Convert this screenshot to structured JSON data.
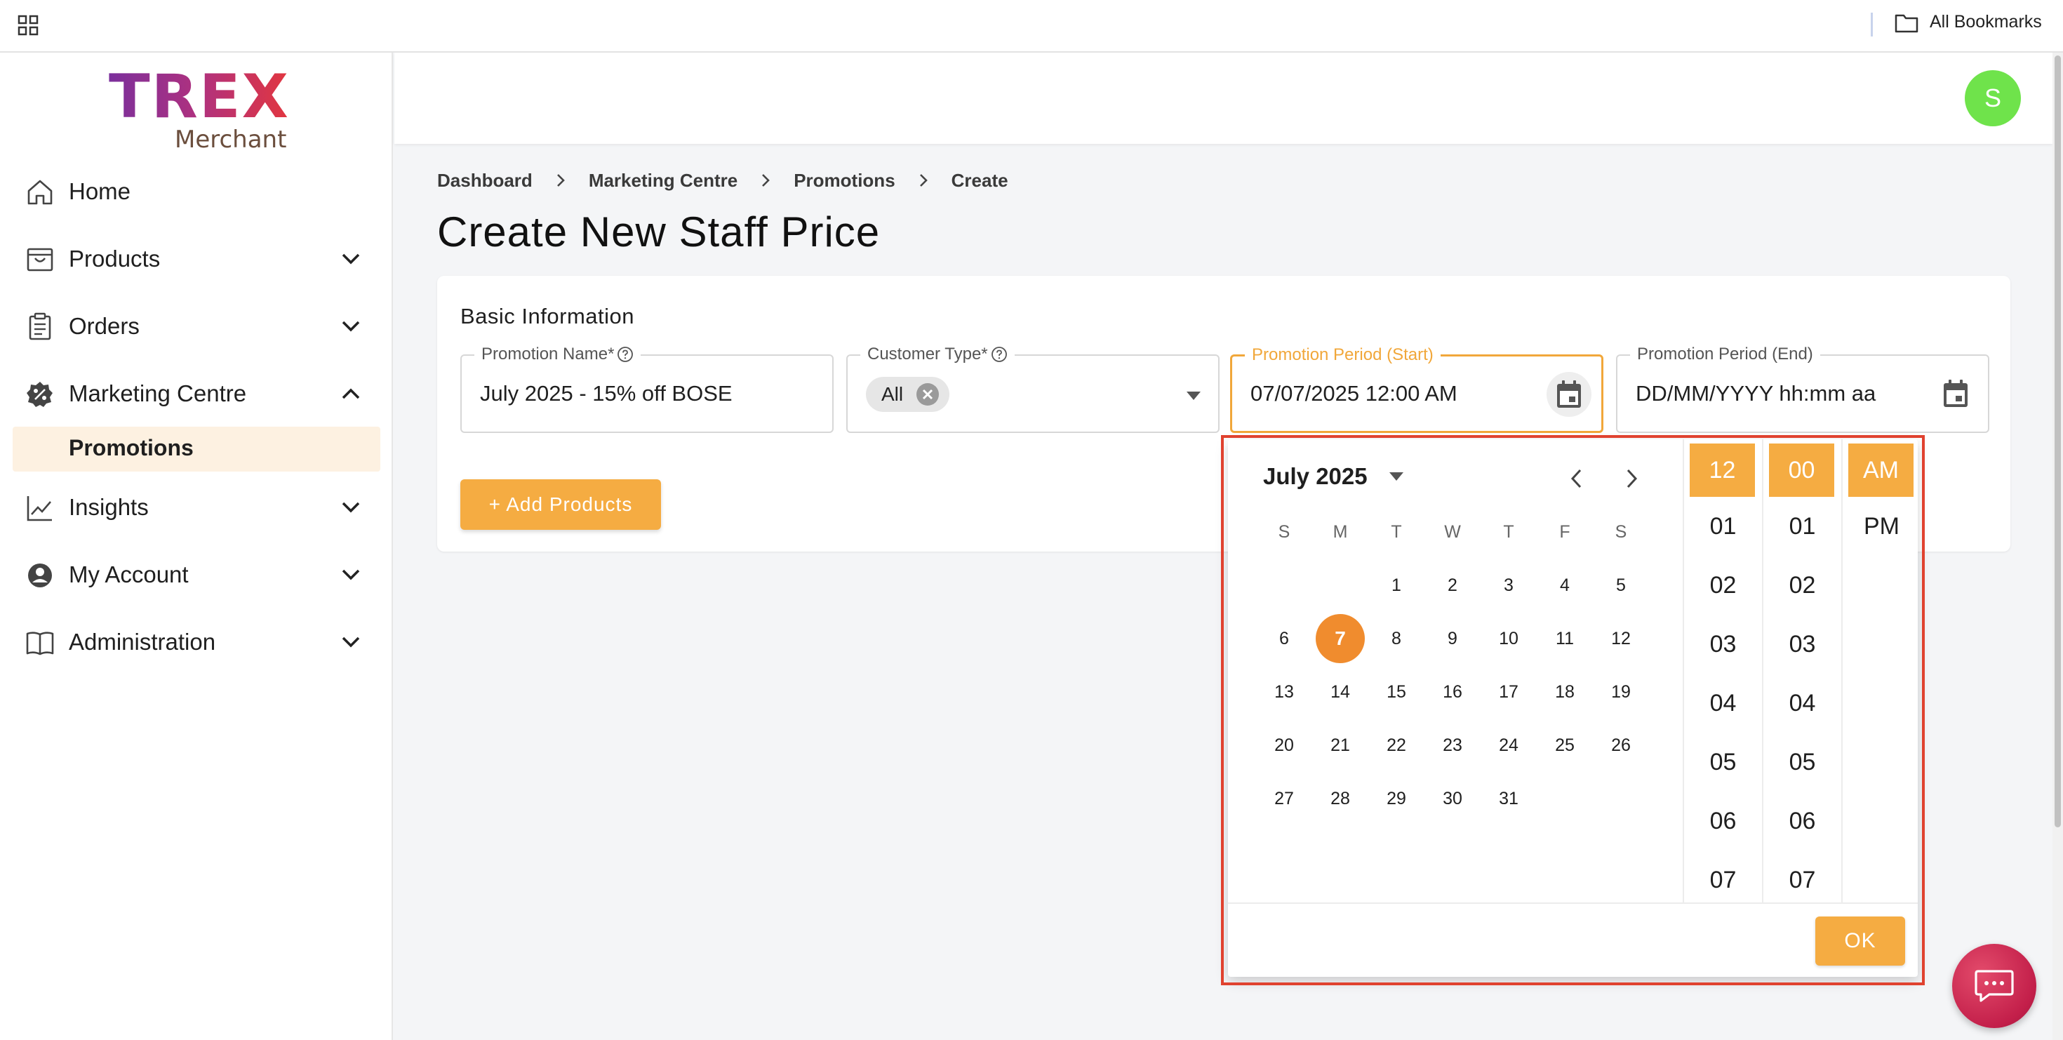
{
  "bookmarks": {
    "all_bookmarks_label": "All Bookmarks"
  },
  "logo": {
    "brand": "TREX",
    "sub": "Merchant"
  },
  "sidebar": {
    "items": [
      {
        "label": "Home",
        "icon": "home-icon"
      },
      {
        "label": "Products",
        "icon": "shopping-bag-icon"
      },
      {
        "label": "Orders",
        "icon": "clipboard-icon"
      },
      {
        "label": "Marketing Centre",
        "icon": "discount-badge-icon"
      },
      {
        "label": "Insights",
        "icon": "trending-chart-icon"
      },
      {
        "label": "My Account",
        "icon": "account-circle-icon"
      },
      {
        "label": "Administration",
        "icon": "book-icon"
      }
    ],
    "subitem": {
      "label": "Promotions"
    }
  },
  "header": {
    "avatar_initial": "S"
  },
  "breadcrumb": [
    "Dashboard",
    "Marketing Centre",
    "Promotions",
    "Create"
  ],
  "page_title": "Create New Staff Price",
  "basic_info": {
    "title": "Basic Information",
    "promotion_name": {
      "label": "Promotion Name*",
      "value": "July 2025 - 15% off BOSE"
    },
    "customer_type": {
      "label": "Customer Type*",
      "chip": "All"
    },
    "period_start": {
      "label": "Promotion Period (Start)",
      "value": "07/07/2025 12:00 AM"
    },
    "period_end": {
      "label": "Promotion Period (End)",
      "placeholder": "DD/MM/YYYY hh:mm aa"
    },
    "add_products_label": "+ Add Products"
  },
  "picker": {
    "month_label": "July 2025",
    "weekdays": [
      "S",
      "M",
      "T",
      "W",
      "T",
      "F",
      "S"
    ],
    "weeks": [
      [
        "",
        "",
        "1",
        "2",
        "3",
        "4",
        "5"
      ],
      [
        "6",
        "7",
        "8",
        "9",
        "10",
        "11",
        "12"
      ],
      [
        "13",
        "14",
        "15",
        "16",
        "17",
        "18",
        "19"
      ],
      [
        "20",
        "21",
        "22",
        "23",
        "24",
        "25",
        "26"
      ],
      [
        "27",
        "28",
        "29",
        "30",
        "31",
        "",
        ""
      ]
    ],
    "selected_day": "7",
    "hours": [
      "12",
      "01",
      "02",
      "03",
      "04",
      "05",
      "06",
      "07"
    ],
    "minutes": [
      "00",
      "01",
      "02",
      "03",
      "04",
      "05",
      "06",
      "07"
    ],
    "meridiem": [
      "AM",
      "PM"
    ],
    "selected_hour": "12",
    "selected_minute": "00",
    "selected_meridiem": "AM",
    "ok_label": "OK"
  },
  "colors": {
    "accent": "#f5ac42",
    "selected_day": "#f08c2e",
    "highlight_outline": "#e0422f",
    "avatar": "#6fe34b"
  }
}
